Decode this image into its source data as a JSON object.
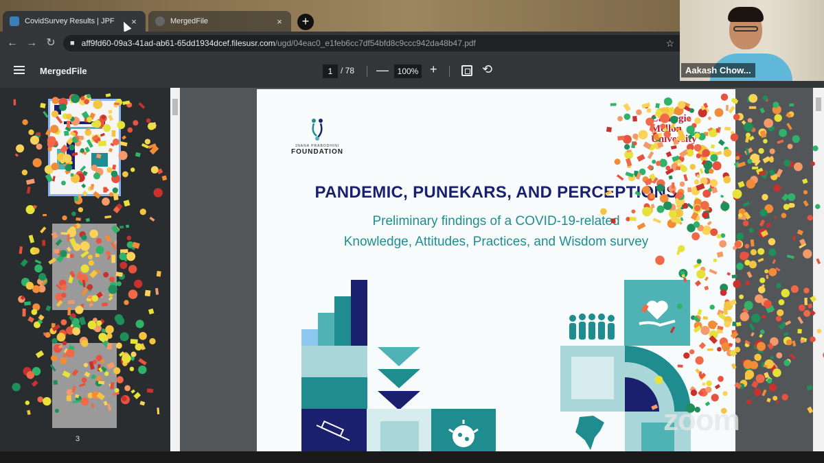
{
  "browser": {
    "tabs": [
      {
        "title": "CovidSurvey Results | JPF",
        "active": true
      },
      {
        "title": "MergedFile",
        "active": false
      }
    ],
    "new_tab_label": "+",
    "close_glyph": "×",
    "url_host": "aff9fd60-09a3-41ad-ab61-65dd1934dcef.filesusr.com",
    "url_path": "/ugd/04eac0_e1feb6cc7df54bfd8c9ccc942da48b47.pdf"
  },
  "pdf_viewer": {
    "title": "MergedFile",
    "current_page": "1",
    "total_pages": "/ 78",
    "zoom": "100%",
    "zoom_minus": "—",
    "zoom_plus": "+",
    "thumbnail_page_label": "3"
  },
  "page": {
    "jpf_small": "JNANA PRABODHINI",
    "jpf_big": "FOUNDATION",
    "cmu_lines": [
      "Carnegie",
      "Mellon",
      "University"
    ],
    "headline": "PANDEMIC, PUNEKARS, AND PERCEPTIONS",
    "subline_1": "Preliminary findings of a COVID-19-related",
    "subline_2": "Knowledge, Attitudes, Practices, and Wisdom survey"
  },
  "zoom_call": {
    "participant_name": "Aakash Chow...",
    "watermark": "zoom"
  },
  "colors": {
    "navy": "#1a1f6e",
    "teal": "#1f8d8f",
    "teal_light": "#a9d6d8",
    "teal_mid": "#4fb3b5",
    "cmu_red": "#b22234"
  },
  "icons": [
    "back-arrow-icon",
    "forward-arrow-icon",
    "reload-icon",
    "lock-icon",
    "star-icon",
    "menu-icon",
    "fit-page-icon",
    "rotate-icon",
    "heart-hand-icon",
    "people-icon",
    "syringe-icon",
    "virus-icon",
    "india-map-icon"
  ]
}
